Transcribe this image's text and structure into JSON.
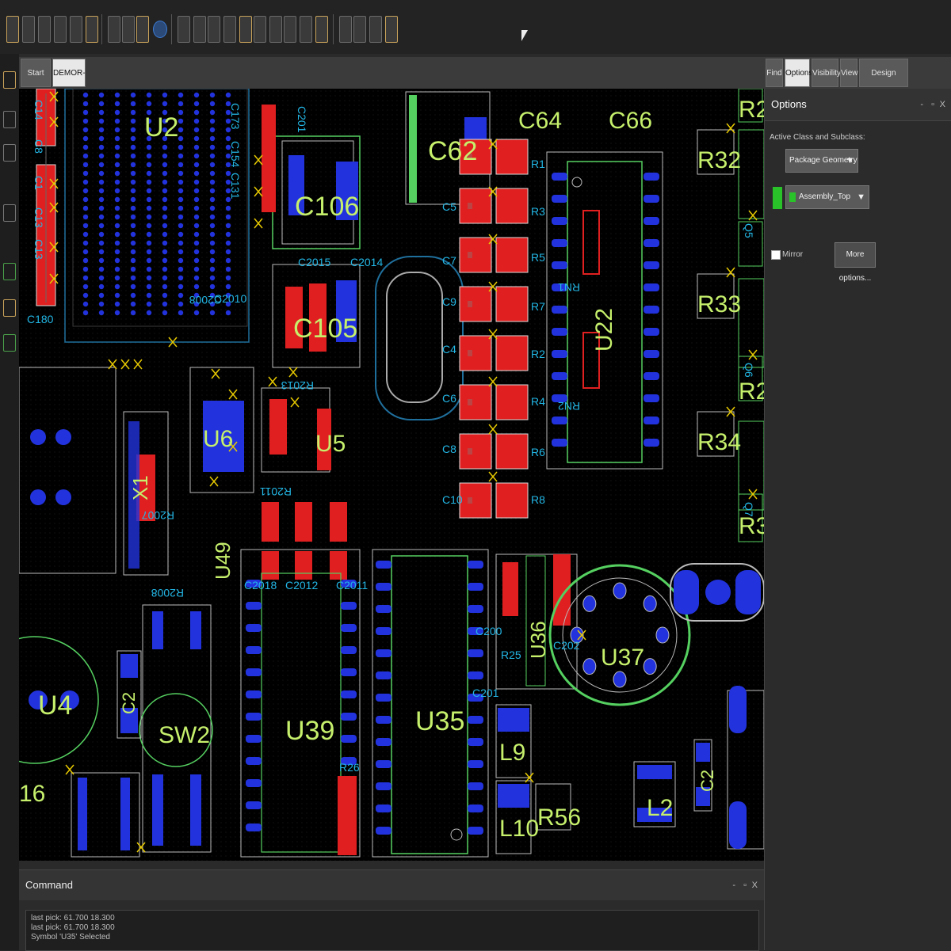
{
  "doc_tabs": [
    {
      "label": "Start Page",
      "active": false
    },
    {
      "label": "DEMOR-dfa",
      "active": true
    }
  ],
  "panel_tabs": [
    {
      "label": "Find"
    },
    {
      "label": "Options"
    },
    {
      "label": "Visibility"
    },
    {
      "label": "View"
    },
    {
      "label": "Design Workflow"
    }
  ],
  "options": {
    "title": "Options",
    "active_class_label": "Active Class and Subclass:",
    "class_value": "Package Geometry",
    "subclass_value": "Assembly_Top",
    "subclass_color": "#29c229",
    "mirror_label": "Mirror",
    "more_options_label": "More options..."
  },
  "command": {
    "title": "Command",
    "lines": [
      "last pick:  61.700 18.300",
      "last pick:  61.700 18.300",
      "Symbol 'U35' Selected"
    ]
  },
  "window_controls": {
    "minimize": "-",
    "float": "▫",
    "close": "X"
  },
  "colors": {
    "canvas_bg": "#000000",
    "silkscreen": "#23b7e6",
    "label_yellow": "#c6f06c",
    "pad_red": "#e02020",
    "pad_blue": "#2233dd",
    "outline_green": "#55d060",
    "via_cross": "#e6c800"
  },
  "board_labels": {
    "refdes": [
      "U2",
      "C62",
      "C64",
      "C66",
      "R32",
      "R2",
      "C106",
      "C105",
      "U22",
      "R33",
      "R2",
      "R34",
      "R3",
      "U6",
      "U5",
      "X1",
      "U49",
      "U39",
      "U35",
      "U36",
      "U37",
      "SW2",
      "C2",
      "L9",
      "L10",
      "R56",
      "L2",
      "C2",
      "U4",
      "16"
    ],
    "silk": [
      "C14",
      "C8",
      "C1",
      "C13",
      "C13",
      "C180",
      "C173",
      "C154",
      "C131",
      "C201",
      "C2015",
      "C2014",
      "C2010",
      "C2008",
      "R2013",
      "R2011",
      "R2007",
      "R2008",
      "C2018",
      "C2012",
      "C2011",
      "C200",
      "C202",
      "R25",
      "R26",
      "C201",
      "RN1",
      "RN2",
      "C5",
      "C7",
      "C9",
      "C4",
      "C6",
      "C8",
      "C10",
      "R1",
      "R3",
      "R5",
      "R7",
      "R2",
      "R4",
      "R6",
      "R8",
      "Q5",
      "Q6",
      "Q7"
    ]
  }
}
